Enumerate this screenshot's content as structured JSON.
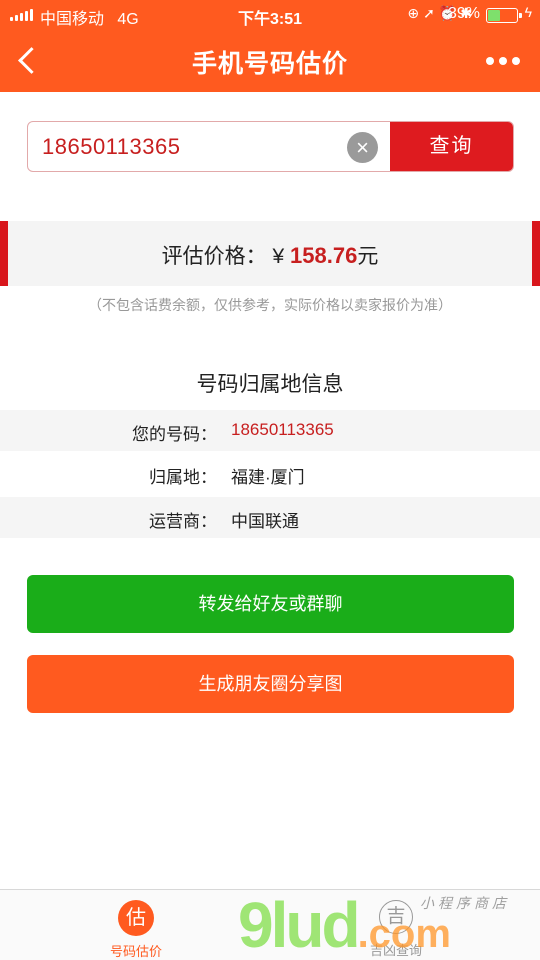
{
  "status": {
    "carrier": "中国移动",
    "network": "4G",
    "time": "下午3:51",
    "battery_text": "39%",
    "battery_level": 0.39
  },
  "nav": {
    "title": "手机号码估价"
  },
  "search": {
    "value": "18650113365",
    "button_label": "查询"
  },
  "price": {
    "label": "评估价格：",
    "currency": "¥",
    "amount": "158.76",
    "unit": "元",
    "note": "（不包含话费余额，仅供参考，实际价格以卖家报价为准）"
  },
  "info": {
    "title": "号码归属地信息",
    "rows": [
      {
        "key": "您的号码：",
        "value": "18650113365"
      },
      {
        "key": "归属地：",
        "value": "福建·厦门"
      },
      {
        "key": "运营商：",
        "value": "中国联通"
      }
    ]
  },
  "actions": {
    "share_friends": "转发给好友或群聊",
    "share_moments": "生成朋友圈分享图"
  },
  "tabs": [
    {
      "icon_char": "估",
      "label": "号码估价"
    },
    {
      "icon_char": "吉",
      "label": "吉凶查询"
    }
  ],
  "watermark": {
    "main": "9lud",
    "domain": ".com",
    "small": "小程序商店"
  },
  "colors": {
    "brand": "#ff5a1f",
    "red": "#de1b1f",
    "green": "#1aad19"
  }
}
